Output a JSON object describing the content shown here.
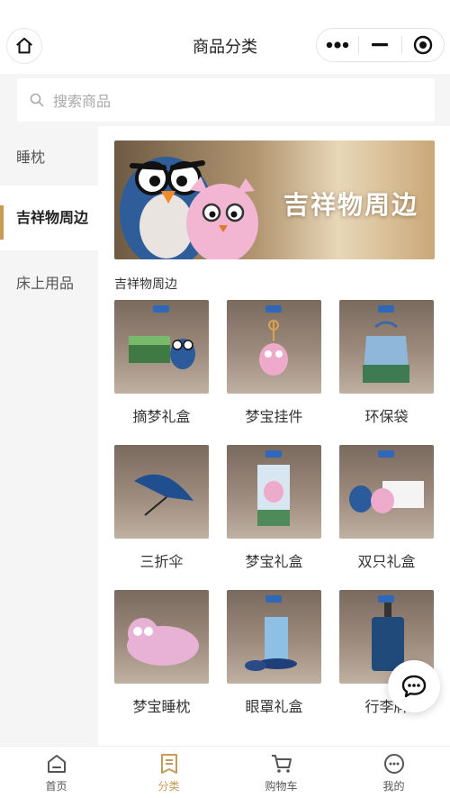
{
  "header": {
    "title": "商品分类",
    "home_icon": "home-icon",
    "capsule": {
      "more_icon": "more-dots-icon",
      "minimize_icon": "minimize-icon",
      "close_icon": "target-close-icon"
    }
  },
  "search": {
    "placeholder": "搜索商品",
    "icon": "search-icon"
  },
  "sidebar": {
    "items": [
      {
        "label": "睡枕",
        "active": false
      },
      {
        "label": "吉祥物周边",
        "active": true
      },
      {
        "label": "床上用品",
        "active": false
      }
    ]
  },
  "banner": {
    "text": "吉祥物周边"
  },
  "section": {
    "title": "吉祥物周边"
  },
  "products": [
    {
      "name": "摘梦礼盒"
    },
    {
      "name": "梦宝挂件"
    },
    {
      "name": "环保袋"
    },
    {
      "name": "三折伞"
    },
    {
      "name": "梦宝礼盒"
    },
    {
      "name": "双只礼盒"
    },
    {
      "name": "梦宝睡枕"
    },
    {
      "name": "眼罩礼盒"
    },
    {
      "name": "行李牌"
    }
  ],
  "chat": {
    "icon": "chat-bubble-icon"
  },
  "tabbar": {
    "items": [
      {
        "label": "首页",
        "icon": "home-tab-icon"
      },
      {
        "label": "分类",
        "icon": "category-tab-icon",
        "active": true
      },
      {
        "label": "购物车",
        "icon": "cart-tab-icon"
      },
      {
        "label": "我的",
        "icon": "profile-tab-icon"
      }
    ]
  },
  "colors": {
    "accent": "#c59b55",
    "background": "#f5f5f5"
  }
}
